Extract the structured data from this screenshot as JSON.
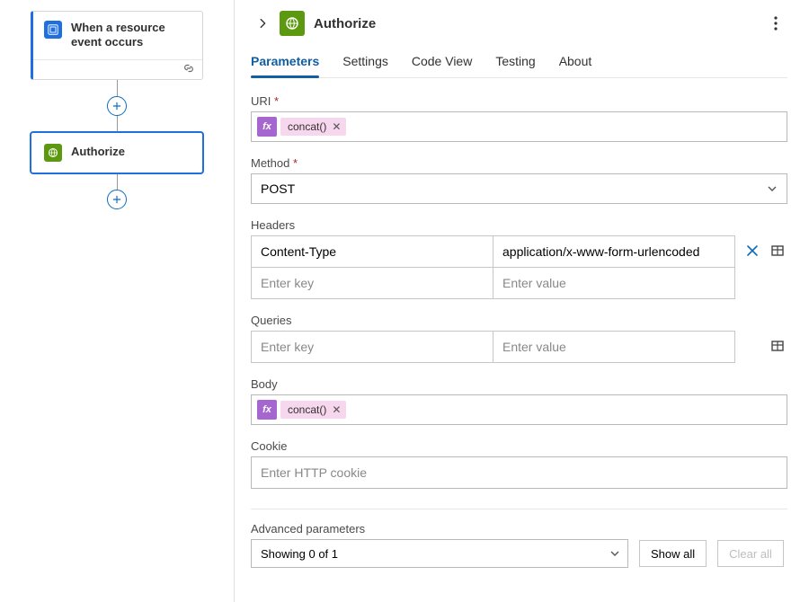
{
  "canvas": {
    "trigger": {
      "title": "When a resource event occurs"
    },
    "action": {
      "title": "Authorize"
    }
  },
  "panel": {
    "title": "Authorize",
    "tabs": {
      "parameters": "Parameters",
      "settings": "Settings",
      "codeview": "Code View",
      "testing": "Testing",
      "about": "About"
    },
    "uri": {
      "label": "URI",
      "token": "concat()"
    },
    "method": {
      "label": "Method",
      "value": "POST"
    },
    "headers": {
      "label": "Headers",
      "rows": [
        {
          "key": "Content-Type",
          "value": "application/x-www-form-urlencoded"
        }
      ],
      "key_placeholder": "Enter key",
      "value_placeholder": "Enter value"
    },
    "queries": {
      "label": "Queries",
      "key_placeholder": "Enter key",
      "value_placeholder": "Enter value"
    },
    "body": {
      "label": "Body",
      "token": "concat()"
    },
    "cookie": {
      "label": "Cookie",
      "placeholder": "Enter HTTP cookie"
    },
    "advanced": {
      "label": "Advanced parameters",
      "selected": "Showing 0 of 1",
      "show_all": "Show all",
      "clear_all": "Clear all"
    }
  }
}
